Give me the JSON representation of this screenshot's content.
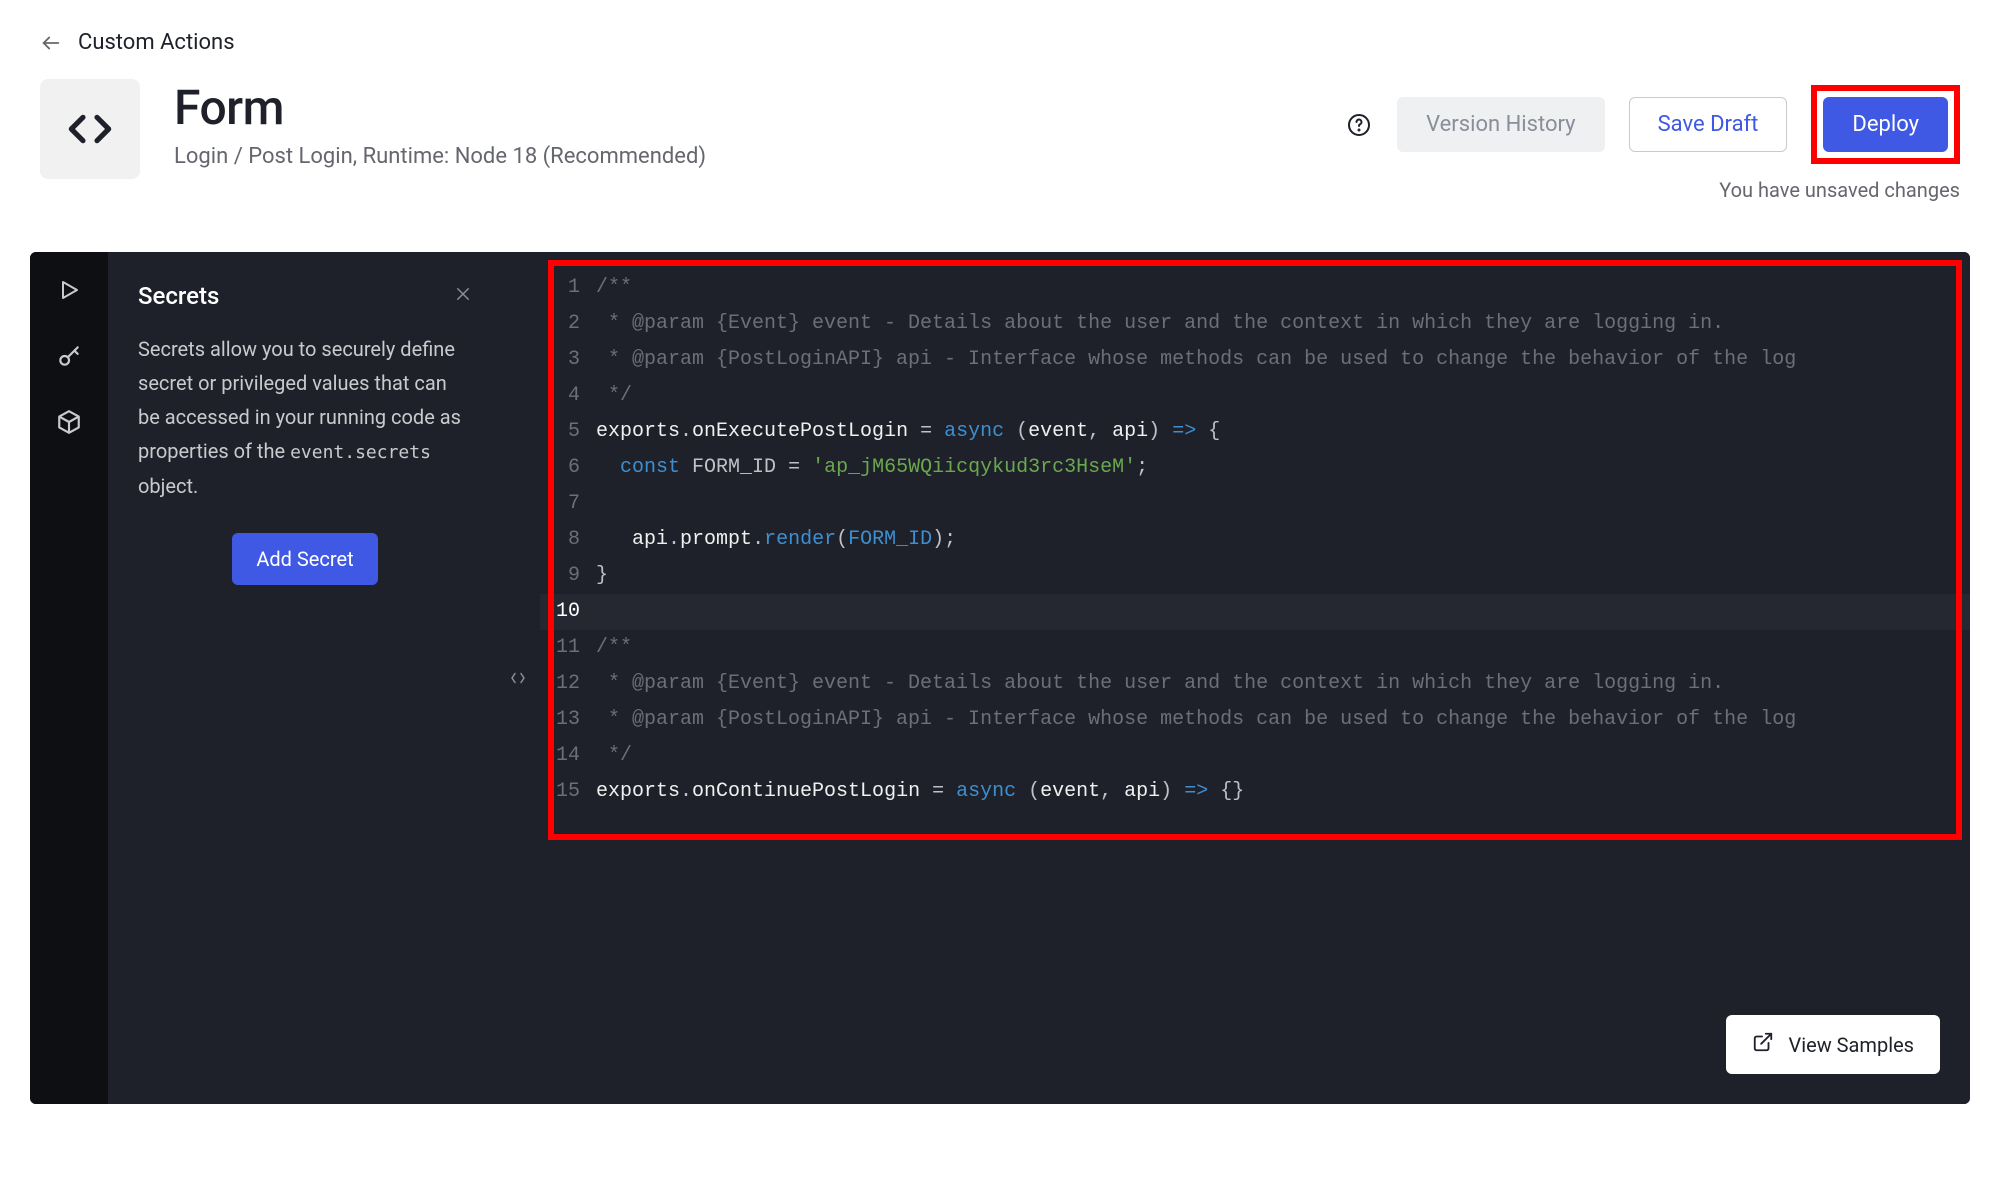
{
  "breadcrumb": {
    "back_label": "Custom Actions"
  },
  "header": {
    "title": "Form",
    "subtitle": "Login / Post Login, Runtime: Node 18 (Recommended)",
    "version_history_label": "Version History",
    "save_draft_label": "Save Draft",
    "deploy_label": "Deploy",
    "unsaved_note": "You have unsaved changes"
  },
  "secrets_panel": {
    "title": "Secrets",
    "description_pre": "Secrets allow you to securely define secret or privileged values that can be accessed in your running code as properties of the ",
    "description_code": "event.secrets",
    "description_post": " object.",
    "add_button_label": "Add Secret"
  },
  "code": {
    "current_line": 10,
    "lines": [
      {
        "n": 1,
        "tokens": [
          [
            "comment",
            "/**"
          ]
        ]
      },
      {
        "n": 2,
        "tokens": [
          [
            "comment",
            " * @param {Event} event - Details about the user and the context in which they are logging in."
          ]
        ]
      },
      {
        "n": 3,
        "tokens": [
          [
            "comment",
            " * @param {PostLoginAPI} api - Interface whose methods can be used to change the behavior of the log"
          ]
        ]
      },
      {
        "n": 4,
        "tokens": [
          [
            "comment",
            " */"
          ]
        ]
      },
      {
        "n": 5,
        "tokens": [
          [
            "property",
            "exports"
          ],
          [
            "paren",
            "."
          ],
          [
            "property",
            "onExecutePostLogin"
          ],
          [
            "paren",
            " = "
          ],
          [
            "func",
            "async"
          ],
          [
            "paren",
            " ("
          ],
          [
            "ident",
            "event"
          ],
          [
            "paren",
            ", "
          ],
          [
            "ident",
            "api"
          ],
          [
            "paren",
            ") "
          ],
          [
            "arrow",
            "=>"
          ],
          [
            "paren",
            " {"
          ]
        ]
      },
      {
        "n": 6,
        "tokens": [
          [
            "paren",
            "  "
          ],
          [
            "keyword",
            "const"
          ],
          [
            "paren",
            " "
          ],
          [
            "const",
            "FORM_ID"
          ],
          [
            "paren",
            " = "
          ],
          [
            "string",
            "'ap_jM65WQiicqykud3rc3HseM'"
          ],
          [
            "paren",
            ";"
          ]
        ]
      },
      {
        "n": 7,
        "tokens": [
          [
            "paren",
            ""
          ]
        ]
      },
      {
        "n": 8,
        "tokens": [
          [
            "paren",
            "   "
          ],
          [
            "ident",
            "api"
          ],
          [
            "paren",
            "."
          ],
          [
            "ident",
            "prompt"
          ],
          [
            "paren",
            "."
          ],
          [
            "func",
            "render"
          ],
          [
            "paren",
            "("
          ],
          [
            "formid",
            "FORM_ID"
          ],
          [
            "paren",
            ");"
          ]
        ]
      },
      {
        "n": 9,
        "tokens": [
          [
            "paren",
            "}"
          ]
        ]
      },
      {
        "n": 10,
        "tokens": [
          [
            "paren",
            ""
          ]
        ]
      },
      {
        "n": 11,
        "tokens": [
          [
            "comment",
            "/**"
          ]
        ]
      },
      {
        "n": 12,
        "tokens": [
          [
            "comment",
            " * @param {Event} event - Details about the user and the context in which they are logging in."
          ]
        ]
      },
      {
        "n": 13,
        "tokens": [
          [
            "comment",
            " * @param {PostLoginAPI} api - Interface whose methods can be used to change the behavior of the log"
          ]
        ]
      },
      {
        "n": 14,
        "tokens": [
          [
            "comment",
            " */"
          ]
        ]
      },
      {
        "n": 15,
        "tokens": [
          [
            "property",
            "exports"
          ],
          [
            "paren",
            "."
          ],
          [
            "property",
            "onContinuePostLogin"
          ],
          [
            "paren",
            " = "
          ],
          [
            "func",
            "async"
          ],
          [
            "paren",
            " ("
          ],
          [
            "ident",
            "event"
          ],
          [
            "paren",
            ", "
          ],
          [
            "ident",
            "api"
          ],
          [
            "paren",
            ") "
          ],
          [
            "arrow",
            "=>"
          ],
          [
            "paren",
            " {}"
          ]
        ]
      }
    ]
  },
  "view_samples_label": "View Samples",
  "highlight_colors": {
    "red": "#ff0000"
  }
}
